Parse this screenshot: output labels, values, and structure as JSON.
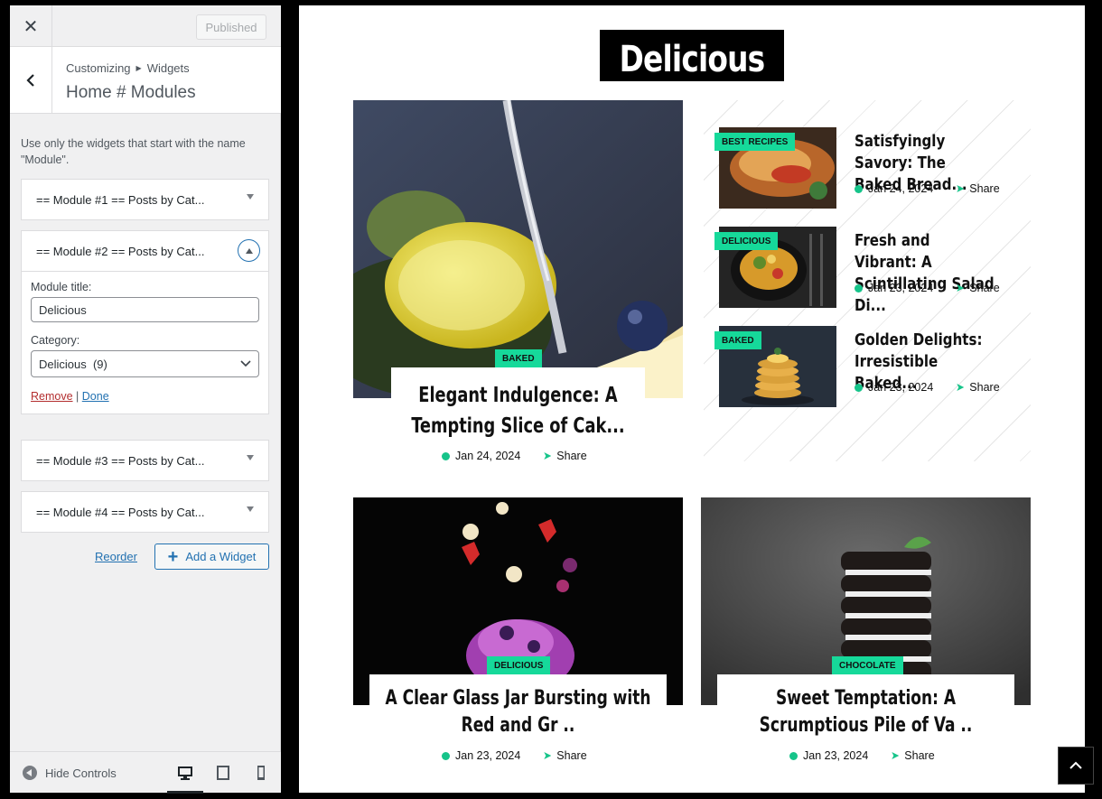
{
  "customizer": {
    "publish_label": "Published",
    "breadcrumb_root": "Customizing",
    "breadcrumb_child": "Widgets",
    "section_title": "Home # Modules",
    "description": "Use only the widgets that start with the name \"Module\".",
    "widgets": [
      {
        "title": "== Module #1 == Posts by Cat..."
      },
      {
        "title": "== Module #2 == Posts by Cat..."
      },
      {
        "title": "== Module #3 == Posts by Cat..."
      },
      {
        "title": "== Module #4 == Posts by Cat..."
      }
    ],
    "open_widget": {
      "module_title_label": "Module title:",
      "module_title_value": "Delicious",
      "category_label": "Category:",
      "category_value": "Delicious  (9)",
      "remove_label": "Remove",
      "separator": "|",
      "done_label": "Done"
    },
    "reorder_label": "Reorder",
    "add_widget_label": "Add a Widget",
    "hide_controls_label": "Hide Controls",
    "device_icons": [
      "desktop-icon",
      "tablet-icon",
      "mobile-icon"
    ]
  },
  "preview": {
    "module_title": "Delicious",
    "featured": {
      "badge": "Baked",
      "title": "Elegant Indulgence: A Tempting Slice of Cak...",
      "date": "Jan 24, 2024",
      "share": "Share"
    },
    "list": [
      {
        "badge": "Best Recipes",
        "title": "Satisfyingly Savory: The Baked Bread...",
        "date": "Jan 24, 2024",
        "share": "Share"
      },
      {
        "badge": "Delicious",
        "title": "Fresh and Vibrant: A Scintillating Salad Di...",
        "date": "Jan 23, 2024",
        "share": "Share"
      },
      {
        "badge": "Baked",
        "title": "Golden Delights: Irresistible Baked...",
        "date": "Jan 23, 2024",
        "share": "Share"
      }
    ],
    "bottom": [
      {
        "badge": "Delicious",
        "title": "A Clear Glass Jar Bursting with Red and Gr ..",
        "date": "Jan 23, 2024",
        "share": "Share"
      },
      {
        "badge": "Chocolate",
        "title": "Sweet Temptation: A Scrumptious Pile of Va ..",
        "date": "Jan 23, 2024",
        "share": "Share"
      }
    ],
    "accent_color": "#16d99a"
  }
}
